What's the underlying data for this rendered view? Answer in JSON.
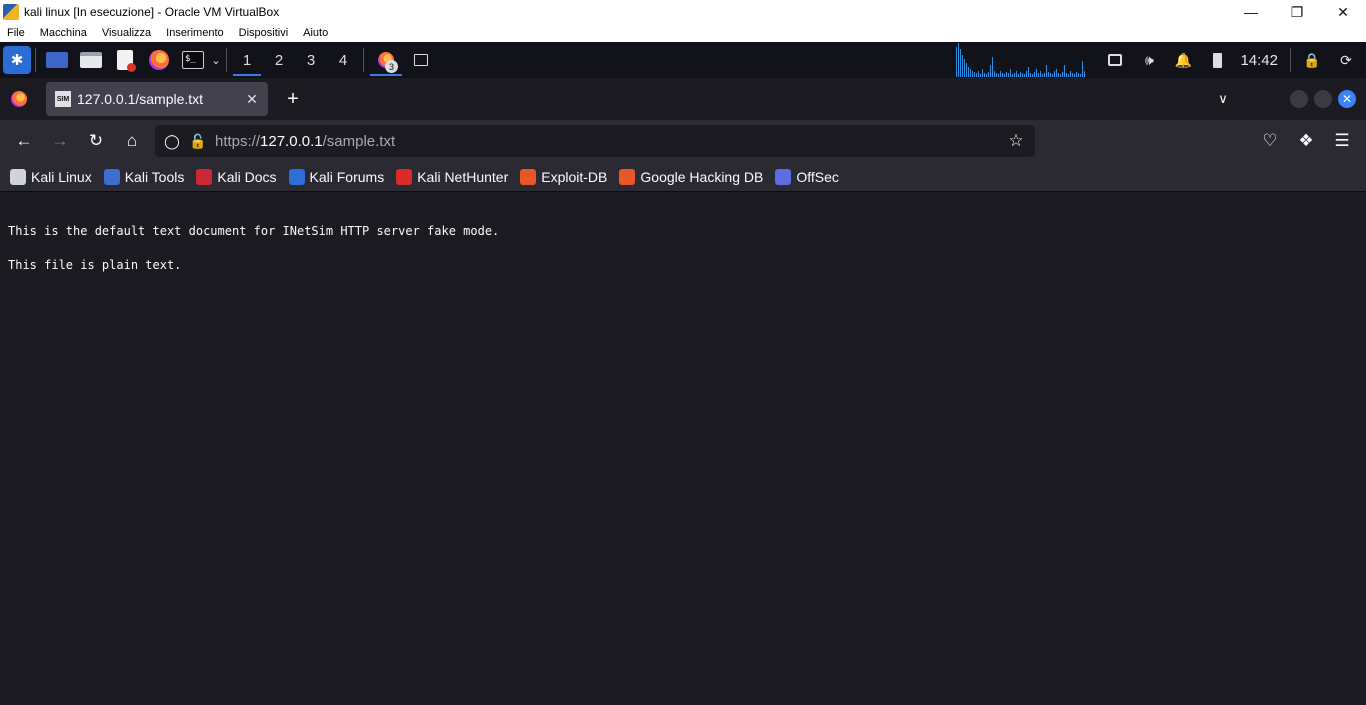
{
  "vbox": {
    "title": "kali linux [In esecuzione] - Oracle VM VirtualBox",
    "menu": [
      "File",
      "Macchina",
      "Visualizza",
      "Inserimento",
      "Dispositivi",
      "Aiuto"
    ]
  },
  "panel": {
    "workspaces": [
      "1",
      "2",
      "3",
      "4"
    ],
    "active_workspace": "1",
    "firefox_window_count": "3",
    "clock": "14:42"
  },
  "firefox": {
    "tab": {
      "title": "127.0.0.1/sample.txt",
      "favicon_text": "SIM"
    },
    "url": {
      "scheme": "https://",
      "host": "127.0.0.1",
      "path": "/sample.txt"
    },
    "bookmarks": [
      {
        "label": "Kali Linux",
        "icon": "kali-dragon-icon",
        "color": "#cfd3de"
      },
      {
        "label": "Kali Tools",
        "icon": "kali-tools-icon",
        "color": "#3d6fd0"
      },
      {
        "label": "Kali Docs",
        "icon": "kali-docs-icon",
        "color": "#cc2936"
      },
      {
        "label": "Kali Forums",
        "icon": "kali-forums-icon",
        "color": "#2c6fd8"
      },
      {
        "label": "Kali NetHunter",
        "icon": "kali-nethunter-icon",
        "color": "#d92b2b"
      },
      {
        "label": "Exploit-DB",
        "icon": "exploit-db-icon",
        "color": "#e8572a"
      },
      {
        "label": "Google Hacking DB",
        "icon": "ghdb-icon",
        "color": "#e8572a"
      },
      {
        "label": "OffSec",
        "icon": "offsec-icon",
        "color": "#5b6de0"
      }
    ]
  },
  "document": {
    "lines": [
      "This is the default text document for INetSim HTTP server fake mode.",
      "This file is plain text."
    ]
  }
}
